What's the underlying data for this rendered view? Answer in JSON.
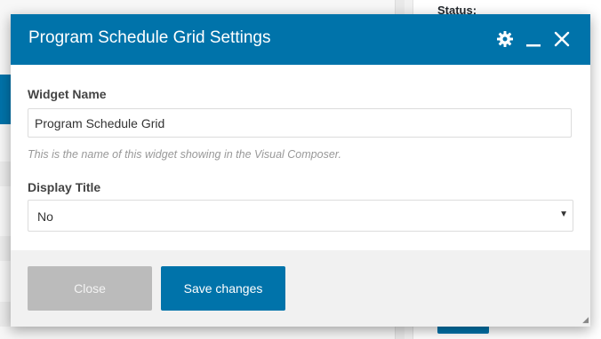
{
  "background": {
    "status_label": "Status:"
  },
  "modal": {
    "title": "Program Schedule Grid Settings",
    "header_icons": [
      "gear-icon",
      "minimize-icon",
      "close-icon"
    ],
    "fields": {
      "widget_name": {
        "label": "Widget Name",
        "value": "Program Schedule Grid",
        "hint": "This is the name of this widget showing in the Visual Composer."
      },
      "display_title": {
        "label": "Display Title",
        "selected": "No"
      }
    },
    "buttons": {
      "close": "Close",
      "save": "Save changes"
    }
  },
  "colors": {
    "accent": "#0073aa",
    "disabled_button": "#bbbbbb",
    "footer_bg": "#f1f1f1"
  }
}
